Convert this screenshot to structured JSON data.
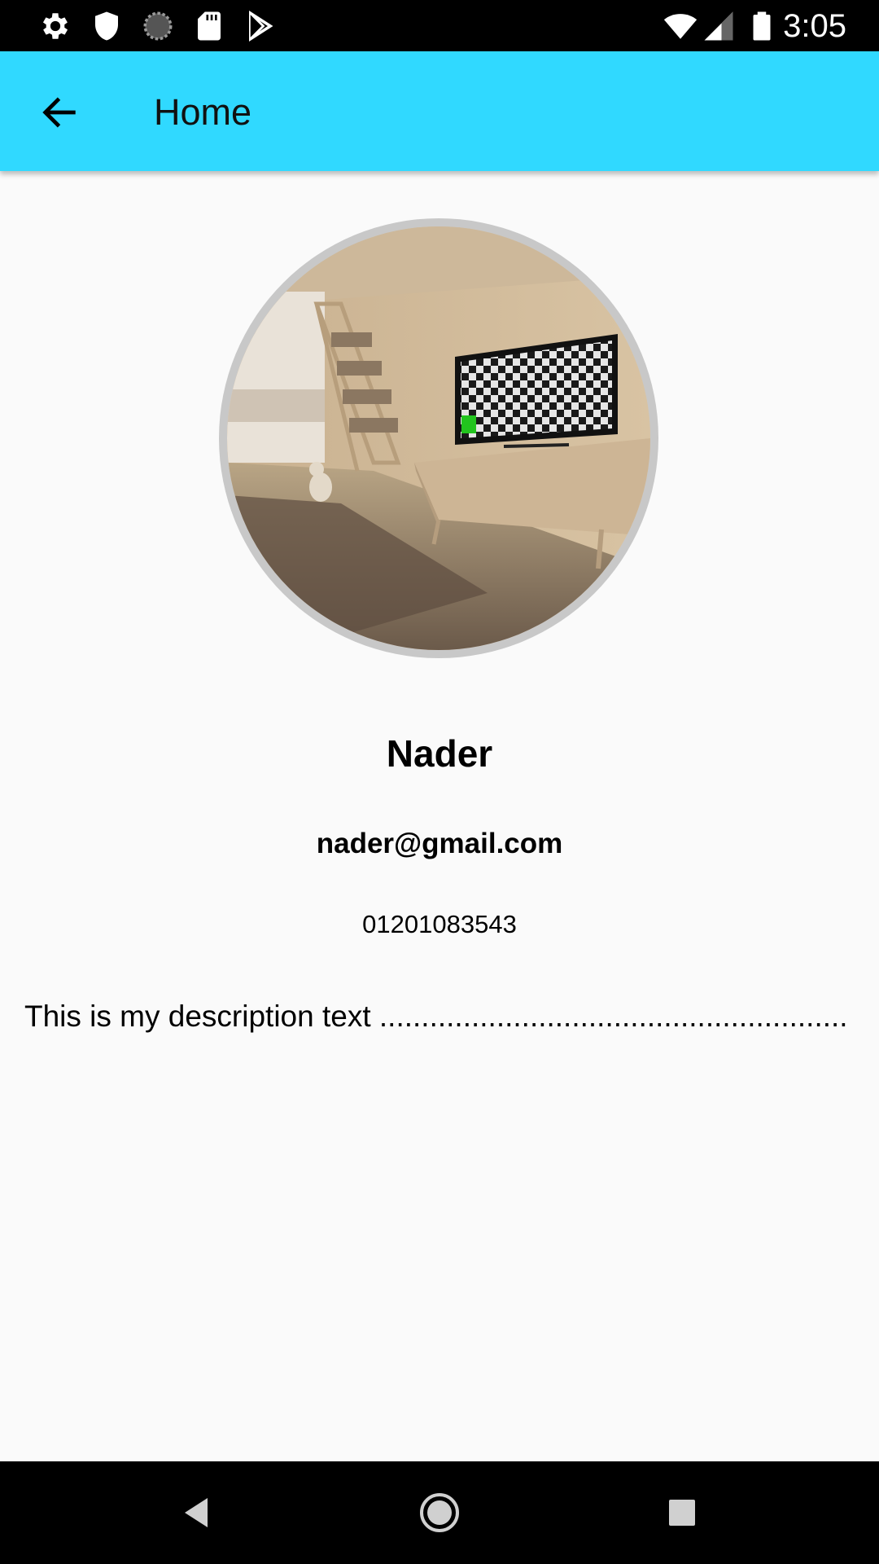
{
  "status_bar": {
    "time": "3:05",
    "left_icons": [
      "settings-icon",
      "shield-icon",
      "sync-icon",
      "sd-card-icon",
      "play-store-icon"
    ],
    "right_icons": [
      "wifi-icon",
      "cell-signal-icon",
      "battery-icon"
    ]
  },
  "app_bar": {
    "title": "Home",
    "back_icon": "arrow-back-icon",
    "background": "#30d9ff"
  },
  "profile": {
    "name": "Nader",
    "email": "nader@gmail.com",
    "phone": "01201083543",
    "description": "This is my description text ........................................................"
  },
  "nav_bar": {
    "buttons": [
      "back-triangle-icon",
      "home-circle-icon",
      "recents-square-icon"
    ]
  }
}
